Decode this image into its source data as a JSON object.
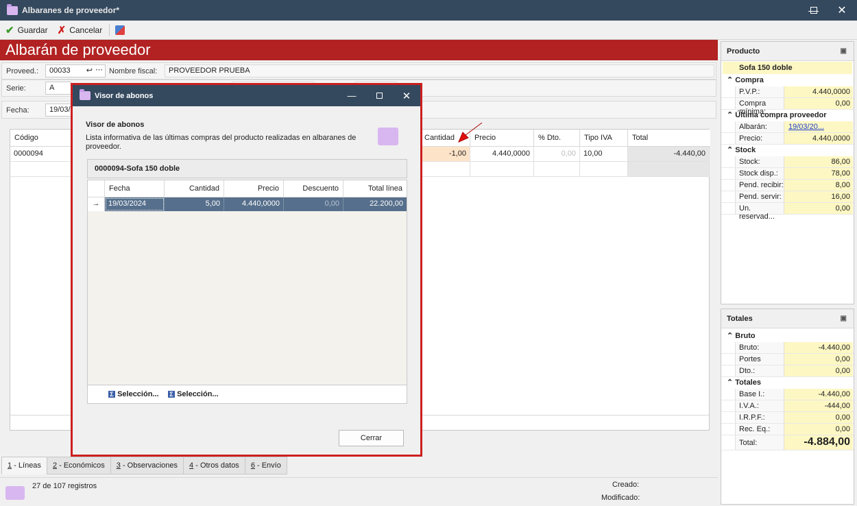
{
  "window": {
    "title": "Albaranes de proveedor*",
    "min_icon": "minimize-icon",
    "max_icon": "maximize-icon",
    "close_icon": "close-icon"
  },
  "toolbar": {
    "save": "Guardar",
    "cancel": "Cancelar"
  },
  "header": {
    "title": "Albarán de proveedor"
  },
  "form": {
    "proveedor_label": "Proveed.:",
    "proveedor_value": "00033",
    "nombre_fiscal_label": "Nombre fiscal:",
    "nombre_fiscal_value": "PROVEEDOR PRUEBA",
    "serie_label": "Serie:",
    "serie_value": "A",
    "fecha_label": "Fecha:",
    "fecha_value": "19/03/"
  },
  "grid": {
    "headers": {
      "codigo": "Código",
      "cantidad": "Cantidad",
      "precio": "Precio",
      "dto": "% Dto.",
      "iva": "Tipo IVA",
      "total": "Total"
    },
    "row": {
      "codigo": "0000094",
      "cantidad": "-1,00",
      "precio": "4.440,0000",
      "dto": "0,00",
      "iva": "10,00",
      "total": "-4.440,00"
    }
  },
  "tabs": [
    {
      "key": "1",
      "label": " - Líneas"
    },
    {
      "key": "2",
      "label": " - Económicos"
    },
    {
      "key": "3",
      "label": " - Observaciones"
    },
    {
      "key": "4",
      "label": " - Otros datos"
    },
    {
      "key": "6",
      "label": " - Envío"
    }
  ],
  "status": {
    "records": "27 de 107 registros",
    "created_label": "Creado:",
    "modified_label": "Modificado:"
  },
  "producto": {
    "header": "Producto",
    "name": "Sofa 150 doble",
    "compra_label": "Compra",
    "pvp_label": "P.V.P.:",
    "pvp_value": "4.440,0000",
    "compra_min_label": "Compra mínima:",
    "compra_min_value": "0,00",
    "ultima_label": "Última compra proveedor",
    "albaran_label": "Albarán:",
    "albaran_value": "19/03/20...",
    "precio_label": "Precio:",
    "precio_value": "4.440,0000",
    "stock_label": "Stock",
    "stock_rows": [
      {
        "label": "Stock:",
        "value": "86,00"
      },
      {
        "label": "Stock disp.:",
        "value": "78,00"
      },
      {
        "label": "Pend. recibir:",
        "value": "8,00"
      },
      {
        "label": "Pend. servir:",
        "value": "16,00"
      },
      {
        "label": "Un. reservad...",
        "value": "0,00"
      }
    ]
  },
  "totales": {
    "header": "Totales",
    "bruto_label": "Bruto",
    "bruto_rows": [
      {
        "label": "Bruto:",
        "value": "-4.440,00"
      },
      {
        "label": "Portes",
        "value": "0,00"
      },
      {
        "label": "Dto.:",
        "value": "0,00"
      }
    ],
    "totales_label": "Totales",
    "totales_rows": [
      {
        "label": "Base I.:",
        "value": "-4.440,00"
      },
      {
        "label": "I.V.A.:",
        "value": "-444,00"
      },
      {
        "label": "I.R.P.F.:",
        "value": "0,00"
      },
      {
        "label": "Rec. Eq.:",
        "value": "0,00"
      }
    ],
    "total_label": "Total:",
    "total_value": "-4.884,00"
  },
  "dialog": {
    "title": "Visor de abonos",
    "heading": "Visor de abonos",
    "description": "Lista informativa de las últimas compras del producto realizadas en albaranes de proveedor.",
    "group": "0000094-Sofa 150 doble",
    "headers": {
      "fecha": "Fecha",
      "cantidad": "Cantidad",
      "precio": "Precio",
      "descuento": "Descuento",
      "total": "Total línea"
    },
    "row": {
      "fecha": "19/03/2024",
      "cantidad": "5,00",
      "precio": "4.440,0000",
      "descuento": "0,00",
      "total": "22.200,00"
    },
    "footer1": "Selección...",
    "footer2": "Selección...",
    "close": "Cerrar"
  },
  "colors": {
    "titlebar": "#34495e",
    "redbar": "#b22222",
    "dialog_border": "#cc1f1f",
    "selected_row": "#566f8c",
    "value_bg": "#fdf7c3"
  }
}
